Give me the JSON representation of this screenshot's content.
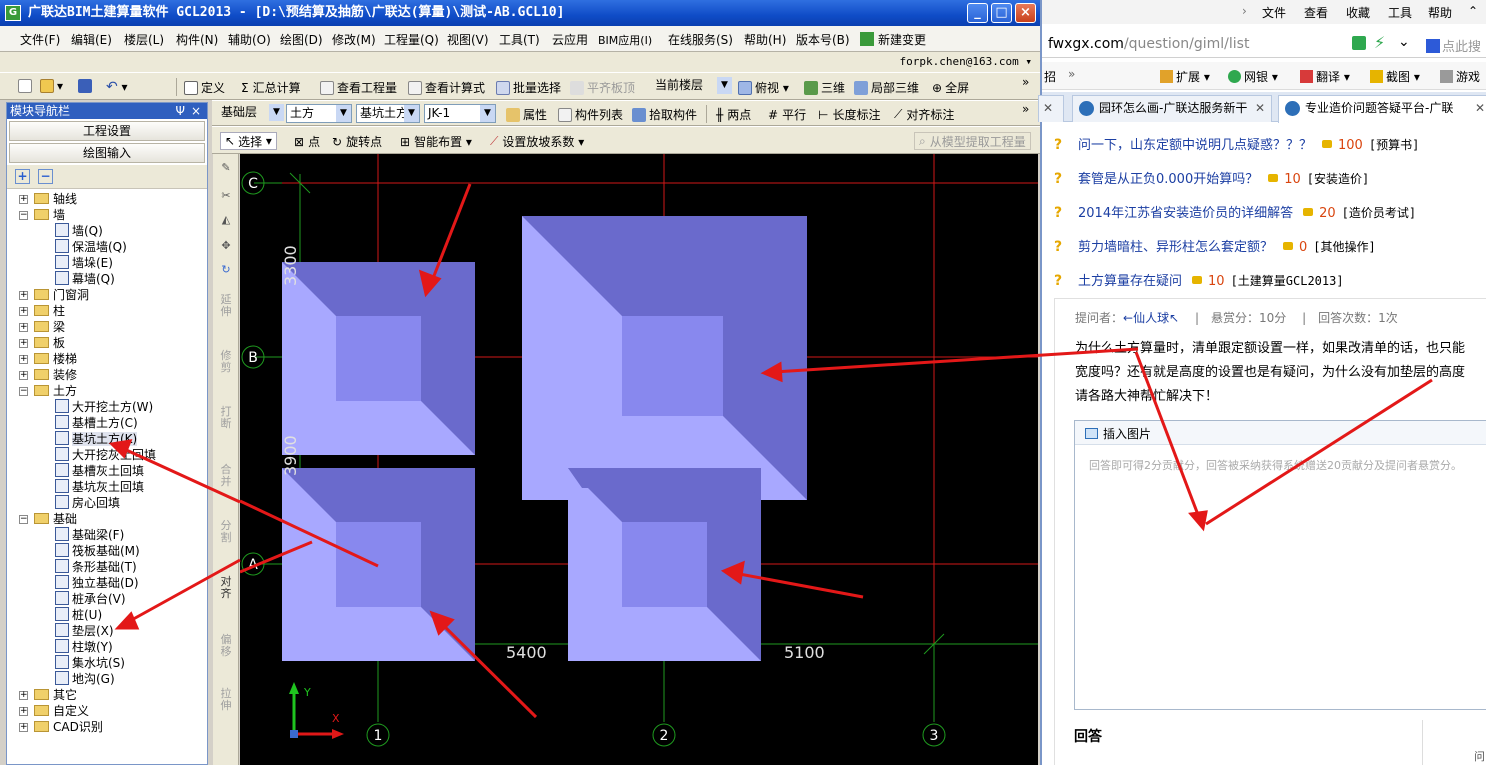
{
  "app": {
    "title": "广联达BIM土建算量软件 GCL2013 - [D:\\预结算及抽筋\\广联达(算量)\\测试-AB.GCL10]",
    "window_buttons": [
      "_",
      "□",
      "×"
    ]
  },
  "menu": [
    "文件(F)",
    "编辑(E)",
    "楼层(L)",
    "构件(N)",
    "辅助(O)",
    "绘图(D)",
    "修改(M)",
    "工程量(Q)",
    "视图(V)",
    "工具(T)",
    "云应用",
    "BIM应用(I)",
    "在线服务(S)",
    "帮助(H)",
    "版本号(B)",
    "新建变更"
  ],
  "user": "forpk.chen@163.com",
  "toolbar1": {
    "define": "定义",
    "sum_calc": "汇总计算",
    "view_qty": "查看工程量",
    "view_formula": "查看计算式",
    "batch_select": "批量选择",
    "flush_slab": "平齐板顶",
    "floor_select": "当前楼层",
    "view_mode": "俯视",
    "three_d": "三维",
    "local_3d": "局部三维",
    "fullscreen": "全屏"
  },
  "toolbar2": {
    "layer": "基础层",
    "type": "土方",
    "sub_type": "基坑土方",
    "component": "JK-1",
    "property": "属性",
    "component_list": "构件列表",
    "pick": "拾取构件",
    "two_point": "两点",
    "parallel": "平行",
    "length_dim": "长度标注",
    "align_dim": "对齐标注"
  },
  "toolbar3": {
    "select": "选择",
    "point": "点",
    "rotate_point": "旋转点",
    "smart_place": "智能布置",
    "slope_factor": "设置放坡系数",
    "extract_qty": "从模型提取工程量"
  },
  "nav": {
    "header": "模块导航栏",
    "pin": "Ψ",
    "close": "×",
    "btn_project": "工程设置",
    "btn_draw": "绘图输入",
    "tree": [
      {
        "label": "轴线",
        "level": 0,
        "folder": true,
        "expand": "+"
      },
      {
        "label": "墙",
        "level": 0,
        "folder": true,
        "expand": "-"
      },
      {
        "label": "墙(Q)",
        "level": 1
      },
      {
        "label": "保温墙(Q)",
        "level": 1
      },
      {
        "label": "墙垛(E)",
        "level": 1
      },
      {
        "label": "幕墙(Q)",
        "level": 1
      },
      {
        "label": "门窗洞",
        "level": 0,
        "folder": true,
        "expand": "+"
      },
      {
        "label": "柱",
        "level": 0,
        "folder": true,
        "expand": "+"
      },
      {
        "label": "梁",
        "level": 0,
        "folder": true,
        "expand": "+"
      },
      {
        "label": "板",
        "level": 0,
        "folder": true,
        "expand": "+"
      },
      {
        "label": "楼梯",
        "level": 0,
        "folder": true,
        "expand": "+"
      },
      {
        "label": "装修",
        "level": 0,
        "folder": true,
        "expand": "+"
      },
      {
        "label": "土方",
        "level": 0,
        "folder": true,
        "expand": "-"
      },
      {
        "label": "大开挖土方(W)",
        "level": 1
      },
      {
        "label": "基槽土方(C)",
        "level": 1
      },
      {
        "label": "基坑土方(K)",
        "level": 1,
        "selected": true
      },
      {
        "label": "大开挖灰土回填",
        "level": 1
      },
      {
        "label": "基槽灰土回填",
        "level": 1
      },
      {
        "label": "基坑灰土回填",
        "level": 1
      },
      {
        "label": "房心回填",
        "level": 1
      },
      {
        "label": "基础",
        "level": 0,
        "folder": true,
        "expand": "-"
      },
      {
        "label": "基础梁(F)",
        "level": 1
      },
      {
        "label": "筏板基础(M)",
        "level": 1
      },
      {
        "label": "条形基础(T)",
        "level": 1
      },
      {
        "label": "独立基础(D)",
        "level": 1
      },
      {
        "label": "桩承台(V)",
        "level": 1
      },
      {
        "label": "桩(U)",
        "level": 1
      },
      {
        "label": "垫层(X)",
        "level": 1
      },
      {
        "label": "柱墩(Y)",
        "level": 1
      },
      {
        "label": "集水坑(S)",
        "level": 1
      },
      {
        "label": "地沟(G)",
        "level": 1
      },
      {
        "label": "其它",
        "level": 0,
        "folder": true,
        "expand": "+"
      },
      {
        "label": "自定义",
        "level": 0,
        "folder": true,
        "expand": "+"
      },
      {
        "label": "CAD识别",
        "level": 0,
        "folder": true,
        "expand": "+"
      }
    ]
  },
  "vertical_tools": [
    "延伸",
    "修剪",
    "打断",
    "合并",
    "分割",
    "对齐",
    "偏移",
    "拉伸"
  ],
  "canvas": {
    "axis_rows": [
      "C",
      "B",
      "A"
    ],
    "axis_cols": [
      "1",
      "2",
      "3"
    ],
    "dim_bottom": [
      "5400",
      "5100"
    ],
    "dim_left": [
      "3300",
      "3900"
    ],
    "ucs_x": "X",
    "ucs_y": "Y"
  },
  "browser": {
    "menu": [
      "文件",
      "查看",
      "收藏",
      "工具",
      "帮助"
    ],
    "url_host": "fwxgx.com",
    "url_path": "/question/giml/list",
    "favbar": [
      "招",
      "»",
      "扩展",
      "网银",
      "翻译",
      "截图",
      "游戏"
    ],
    "search_hint": "点此搜",
    "tabs": [
      "园环怎么画-广联达服务新干",
      "专业造价问题答疑平台-广联"
    ],
    "questions": [
      {
        "title": "问一下，山东定额中说明几点疑惑？？？",
        "points": "100",
        "category": "[预算书]"
      },
      {
        "title": "套管是从正负0.000开始算吗？",
        "points": "10",
        "category": "[安装造价]"
      },
      {
        "title": "2014年江苏省安装造价员的详细解答",
        "points": "20",
        "category": "[造价员考试]"
      },
      {
        "title": "剪力墙暗柱、异形柱怎么套定额？",
        "points": "0",
        "category": "[其他操作]"
      },
      {
        "title": "土方算量存在疑问",
        "points": "10",
        "category": "[土建算量GCL2013]"
      }
    ],
    "detail": {
      "asker_label": "提问者：",
      "asker": "←仙人球↖",
      "bounty": "悬赏分：10分",
      "answers": "回答次数：1次",
      "body": [
        "为什么土方算量时，清单跟定额设置一样，如果改清单的话，也只能",
        "宽度吗？还有就是高度的设置也是有疑问，为什么没有加垫层的高度",
        "请各路大神帮忙解决下！"
      ],
      "insert_image": "插入图片",
      "answer_placeholder": "回答即可得2分贡献分，回答被采纳获得系统赠送20贡献分及提问者悬赏分。",
      "answer_heading": "回答",
      "answer_extra": "问:"
    }
  },
  "colors": {
    "title_bar": "#0f4cc7",
    "pit_outer": "#a8a8ff",
    "pit_slope": "#6a6acc",
    "pit_floor": "#8888ee",
    "axis_red": "#d01818",
    "axis_green": "#1f9a1f",
    "arrow_red": "#e31818",
    "link_blue": "#1c3fa3",
    "points_orange": "#d9450f"
  }
}
